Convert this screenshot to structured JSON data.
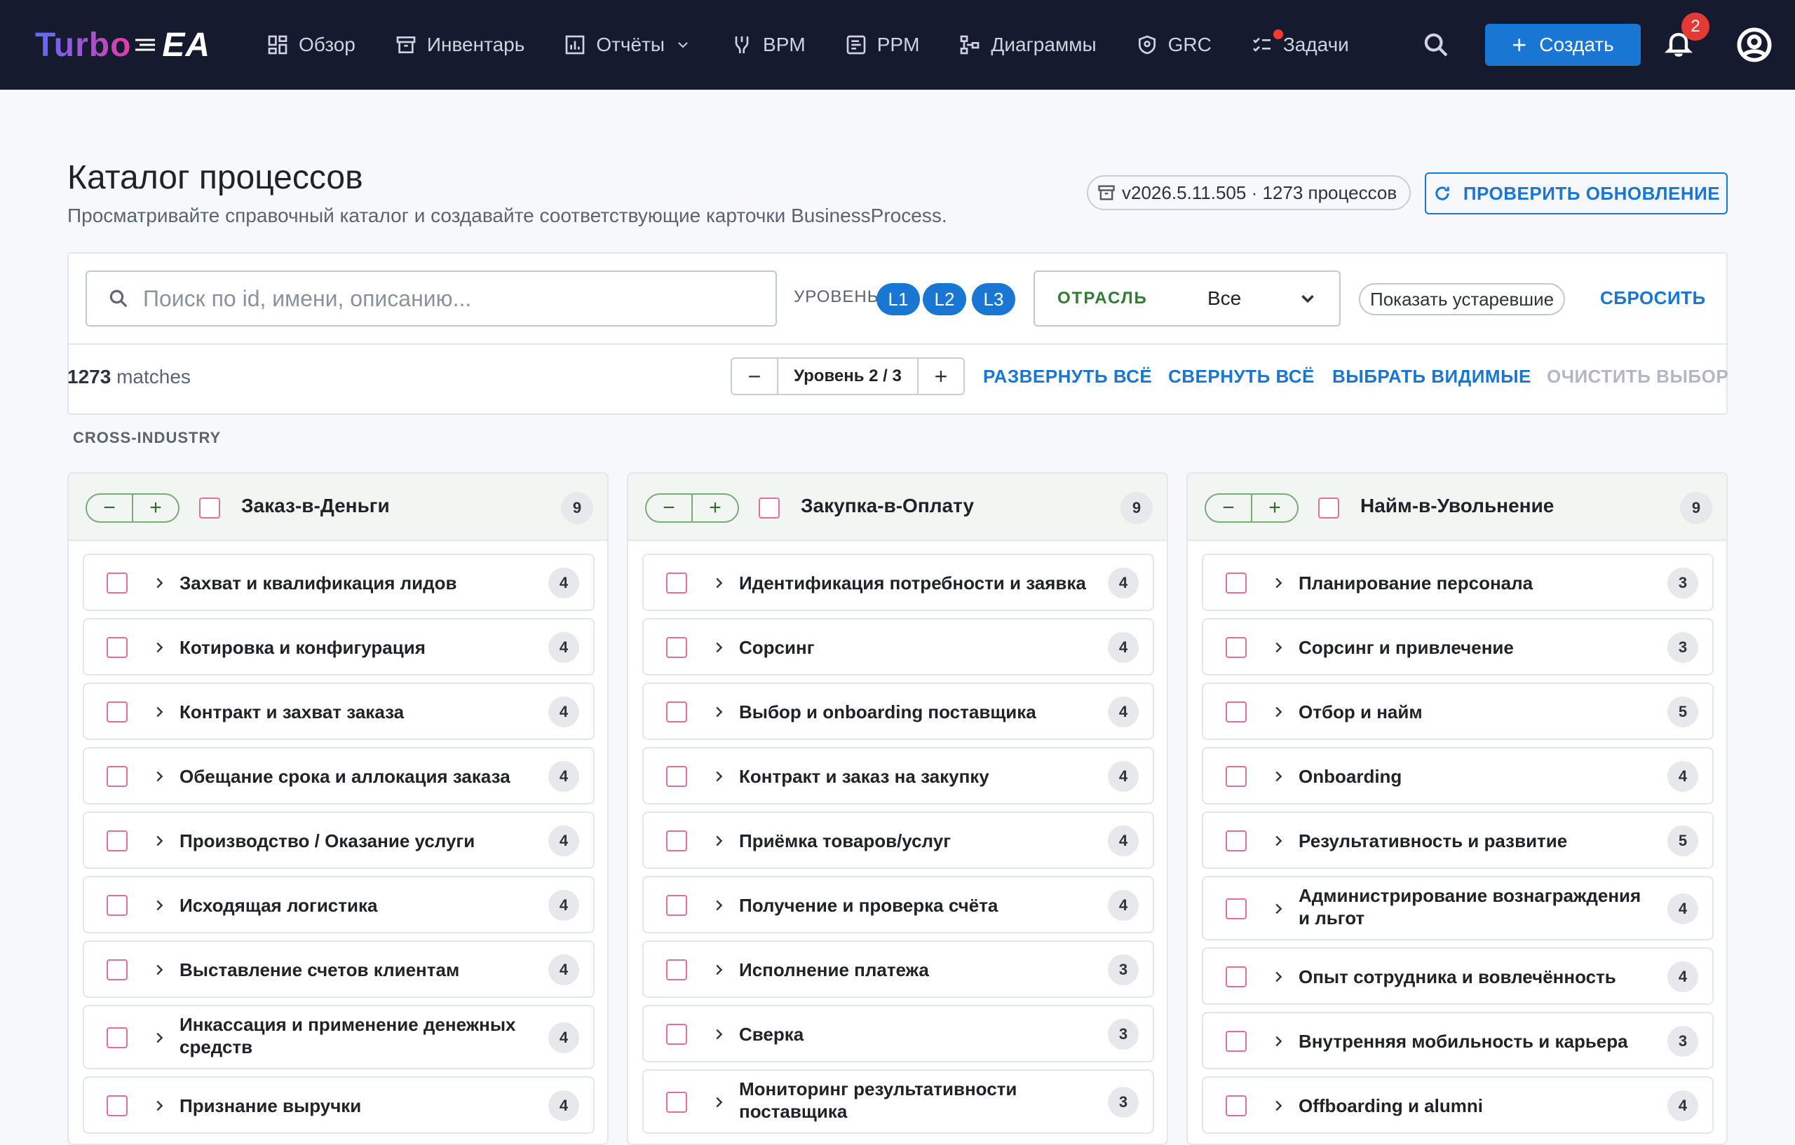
{
  "nav": {
    "logo_turbo": "Turbo",
    "logo_ea": "EA",
    "items": [
      {
        "label": "Обзор",
        "icon": "dashboard-icon"
      },
      {
        "label": "Инвентарь",
        "icon": "archive-icon"
      },
      {
        "label": "Отчёты",
        "icon": "report-icon"
      },
      {
        "label": "BPM",
        "icon": "flow-icon"
      },
      {
        "label": "PPM",
        "icon": "project-icon"
      },
      {
        "label": "Диаграммы",
        "icon": "diagram-icon"
      },
      {
        "label": "GRC",
        "icon": "shield-icon"
      },
      {
        "label": "Задачи",
        "icon": "tasks-icon"
      }
    ],
    "create_label": "Создать",
    "notifications_count": "2"
  },
  "header": {
    "title": "Каталог процессов",
    "subtitle": "Просматривайте справочный каталог и создавайте соответствующие карточки BusinessProcess.",
    "version": "v2026.5.11.505 · 1273 процессов",
    "check_update": "ПРОВЕРИТЬ ОБНОВЛЕНИЕ"
  },
  "filters": {
    "search_placeholder": "Поиск по id, имени, описанию...",
    "level_label": "УРОВЕНЬ",
    "levels": [
      "L1",
      "L2",
      "L3"
    ],
    "industry_label": "ОТРАСЛЬ",
    "industry_value": "Все",
    "show_obsolete": "Показать устаревшие",
    "reset": "СБРОСИТЬ"
  },
  "toolbar": {
    "matches_count": "1273",
    "matches_label": " matches",
    "level_stepper_minus": "−",
    "level_stepper_value": "Уровень 2 / 3",
    "level_stepper_plus": "+",
    "expand_all": "РАЗВЕРНУТЬ ВСЁ",
    "collapse_all": "СВЕРНУТЬ ВСЁ",
    "select_visible": "ВЫБРАТЬ ВИДИМЫЕ",
    "clear_selection": "ОЧИСТИТЬ ВЫБОР"
  },
  "section": "CROSS-INDUSTRY",
  "columns": [
    {
      "title": "Заказ-в-Деньги",
      "count": "9",
      "items": [
        {
          "label": "Захват и квалификация лидов",
          "count": "4"
        },
        {
          "label": "Котировка и конфигурация",
          "count": "4"
        },
        {
          "label": "Контракт и захват заказа",
          "count": "4"
        },
        {
          "label": "Обещание срока и аллокация заказа",
          "count": "4"
        },
        {
          "label": "Производство / Оказание услуги",
          "count": "4"
        },
        {
          "label": "Исходящая логистика",
          "count": "4"
        },
        {
          "label": "Выставление счетов клиентам",
          "count": "4"
        },
        {
          "label": "Инкассация и применение денежных средств",
          "count": "4"
        },
        {
          "label": "Признание выручки",
          "count": "4"
        }
      ]
    },
    {
      "title": "Закупка-в-Оплату",
      "count": "9",
      "items": [
        {
          "label": "Идентификация потребности и заявка",
          "count": "4"
        },
        {
          "label": "Сорсинг",
          "count": "4"
        },
        {
          "label": "Выбор и onboarding поставщика",
          "count": "4"
        },
        {
          "label": "Контракт и заказ на закупку",
          "count": "4"
        },
        {
          "label": "Приёмка товаров/услуг",
          "count": "4"
        },
        {
          "label": "Получение и проверка счёта",
          "count": "4"
        },
        {
          "label": "Исполнение платежа",
          "count": "3"
        },
        {
          "label": "Сверка",
          "count": "3"
        },
        {
          "label": "Мониторинг результативности поставщика",
          "count": "3"
        }
      ]
    },
    {
      "title": "Найм-в-Увольнение",
      "count": "9",
      "items": [
        {
          "label": "Планирование персонала",
          "count": "3"
        },
        {
          "label": "Сорсинг и привлечение",
          "count": "3"
        },
        {
          "label": "Отбор и найм",
          "count": "5"
        },
        {
          "label": "Onboarding",
          "count": "4"
        },
        {
          "label": "Результативность и развитие",
          "count": "5"
        },
        {
          "label": "Администрирование вознаграждения и льгот",
          "count": "4"
        },
        {
          "label": "Опыт сотрудника и вовлечённость",
          "count": "4"
        },
        {
          "label": "Внутренняя мобильность и карьера",
          "count": "3"
        },
        {
          "label": "Offboarding и alumni",
          "count": "4"
        }
      ]
    }
  ]
}
